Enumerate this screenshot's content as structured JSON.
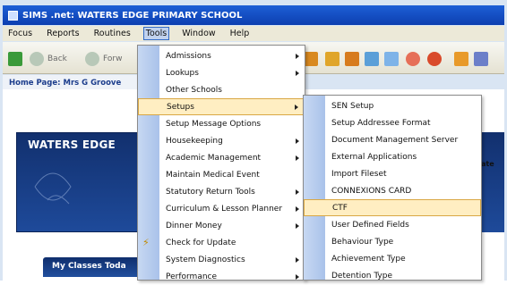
{
  "window": {
    "title": "SIMS .net: WATERS EDGE PRIMARY SCHOOL"
  },
  "menubar": {
    "items": [
      {
        "label": "Focus",
        "active": false
      },
      {
        "label": "Reports",
        "active": false
      },
      {
        "label": "Routines",
        "active": false
      },
      {
        "label": "Tools",
        "active": true
      },
      {
        "label": "Window",
        "active": false
      },
      {
        "label": "Help",
        "active": false
      }
    ]
  },
  "toolbar": {
    "back_label": "Back",
    "forward_label": "Forw"
  },
  "home": {
    "label": "Home Page: Mrs G Groove"
  },
  "banner": {
    "title": "WATERS EDGE",
    "right_text": "ate"
  },
  "myclasses": {
    "label": "My Classes Toda"
  },
  "tools_menu": {
    "items": [
      {
        "label": "Admissions",
        "submenu": true,
        "highlighted": false
      },
      {
        "label": "Lookups",
        "submenu": true,
        "highlighted": false
      },
      {
        "label": "Other Schools",
        "submenu": false,
        "highlighted": false
      },
      {
        "label": "Setups",
        "submenu": true,
        "highlighted": true
      },
      {
        "label": "Setup Message Options",
        "submenu": false,
        "highlighted": false
      },
      {
        "label": "Housekeeping",
        "submenu": true,
        "highlighted": false
      },
      {
        "label": "Academic Management",
        "submenu": true,
        "highlighted": false
      },
      {
        "label": "Maintain Medical Event",
        "submenu": false,
        "highlighted": false
      },
      {
        "label": "Statutory Return Tools",
        "submenu": true,
        "highlighted": false
      },
      {
        "label": "Curriculum & Lesson Planner",
        "submenu": true,
        "highlighted": false
      },
      {
        "label": "Dinner Money",
        "submenu": true,
        "highlighted": false
      },
      {
        "label": "Check for Update",
        "submenu": false,
        "highlighted": false
      },
      {
        "label": "System Diagnostics",
        "submenu": true,
        "highlighted": false
      },
      {
        "label": "Performance",
        "submenu": true,
        "highlighted": false
      }
    ]
  },
  "setups_menu": {
    "items": [
      {
        "label": "SEN Setup",
        "highlighted": false
      },
      {
        "label": "Setup Addressee Format",
        "highlighted": false
      },
      {
        "label": "Document Management Server",
        "highlighted": false
      },
      {
        "label": "External Applications",
        "highlighted": false
      },
      {
        "label": "Import Fileset",
        "highlighted": false
      },
      {
        "label": "CONNEXIONS CARD",
        "highlighted": false
      },
      {
        "label": "CTF",
        "highlighted": true
      },
      {
        "label": "User Defined Fields",
        "highlighted": false
      },
      {
        "label": "Behaviour Type",
        "highlighted": false
      },
      {
        "label": "Achievement Type",
        "highlighted": false
      },
      {
        "label": "Detention Type",
        "highlighted": false
      }
    ]
  }
}
